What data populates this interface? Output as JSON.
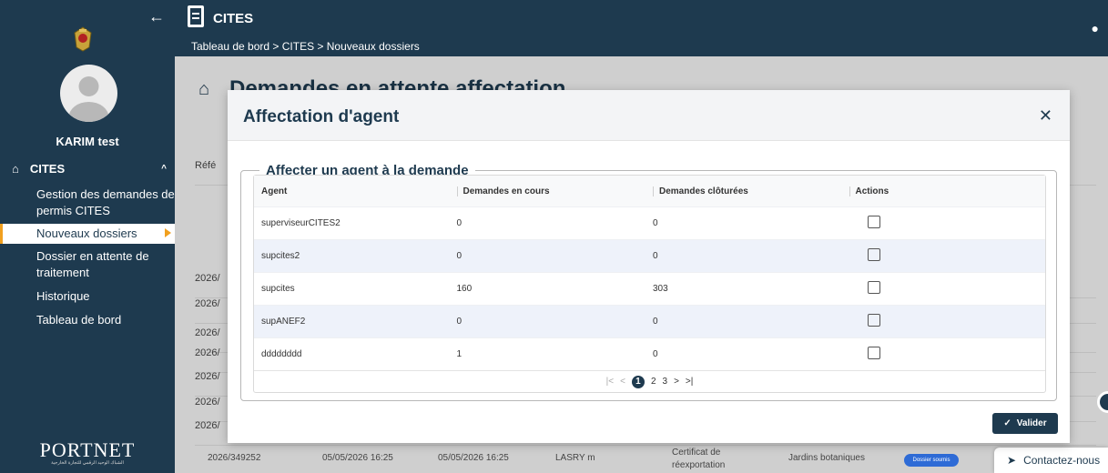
{
  "header": {
    "app_title": "CITES",
    "breadcrumb": "Tableau de bord > CITES > Nouveaux dossiers"
  },
  "sidebar": {
    "username": "KARIM test",
    "section_label": "CITES",
    "items": [
      {
        "label": "Gestion des demandes de permis CITES"
      },
      {
        "label": "Nouveaux dossiers"
      },
      {
        "label": "Dossier en attente de traitement"
      },
      {
        "label": "Historique"
      },
      {
        "label": "Tableau de bord"
      }
    ],
    "logo_text": "PORTNET",
    "logo_subtitle": "الشباك الوحيد الرقمي للتجارة الخارجية"
  },
  "page": {
    "title": "Demandes en attente affectation",
    "bg_prefix_1": "Réfé",
    "bg_prefixes": [
      "2026/",
      "2026/",
      "2026/",
      "2026/",
      "2026/",
      "2026/",
      "2026/"
    ]
  },
  "modal": {
    "title": "Affectation d'agent",
    "legend": "Affecter un agent à la demande",
    "columns": [
      "Agent",
      "Demandes en cours",
      "Demandes clôturées",
      "Actions"
    ],
    "rows": [
      {
        "agent": "superviseurCITES2",
        "en_cours": "0",
        "cloturees": "0"
      },
      {
        "agent": "supcites2",
        "en_cours": "0",
        "cloturees": "0"
      },
      {
        "agent": "supcites",
        "en_cours": "160",
        "cloturees": "303"
      },
      {
        "agent": "supANEF2",
        "en_cours": "0",
        "cloturees": "0"
      },
      {
        "agent": "dddddddd",
        "en_cours": "1",
        "cloturees": "0"
      }
    ],
    "pager": {
      "current": "1",
      "pages": [
        "2",
        "3"
      ]
    },
    "submit_label": "Valider"
  },
  "bottom_row": {
    "ref": "2026/349252",
    "date1": "05/05/2026 16:25",
    "date2": "05/05/2026 16:25",
    "user": "LASRY m",
    "type_line1": "Certificat de",
    "type_line2": "réexportation",
    "org": "Jardins botaniques",
    "status": "Dossier soumis"
  },
  "contact_label": "Contactez-nous",
  "colors": {
    "primary": "#1e3a4f",
    "accent": "#f1a01f"
  }
}
